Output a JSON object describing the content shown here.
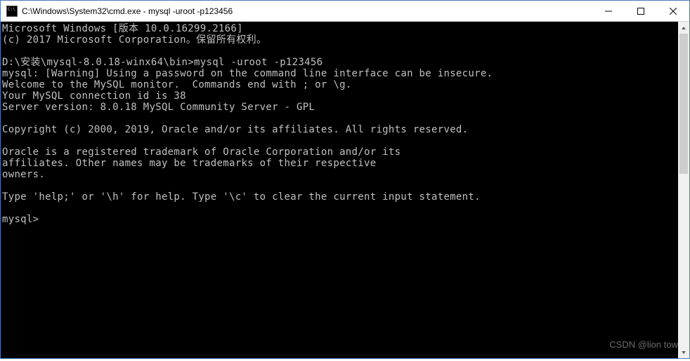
{
  "titlebar": {
    "title": "C:\\Windows\\System32\\cmd.exe - mysql  -uroot -p123456"
  },
  "terminal": {
    "lines": [
      "Microsoft Windows [版本 10.0.16299.2166]",
      "(c) 2017 Microsoft Corporation。保留所有权利。",
      "",
      "D:\\安装\\mysql-8.0.18-winx64\\bin>mysql -uroot -p123456",
      "mysql: [Warning] Using a password on the command line interface can be insecure.",
      "Welcome to the MySQL monitor.  Commands end with ; or \\g.",
      "Your MySQL connection id is 38",
      "Server version: 8.0.18 MySQL Community Server - GPL",
      "",
      "Copyright (c) 2000, 2019, Oracle and/or its affiliates. All rights reserved.",
      "",
      "Oracle is a registered trademark of Oracle Corporation and/or its",
      "affiliates. Other names may be trademarks of their respective",
      "owners.",
      "",
      "Type 'help;' or '\\h' for help. Type '\\c' to clear the current input statement.",
      "",
      "mysql>"
    ]
  },
  "watermark": "CSDN @lion tow"
}
